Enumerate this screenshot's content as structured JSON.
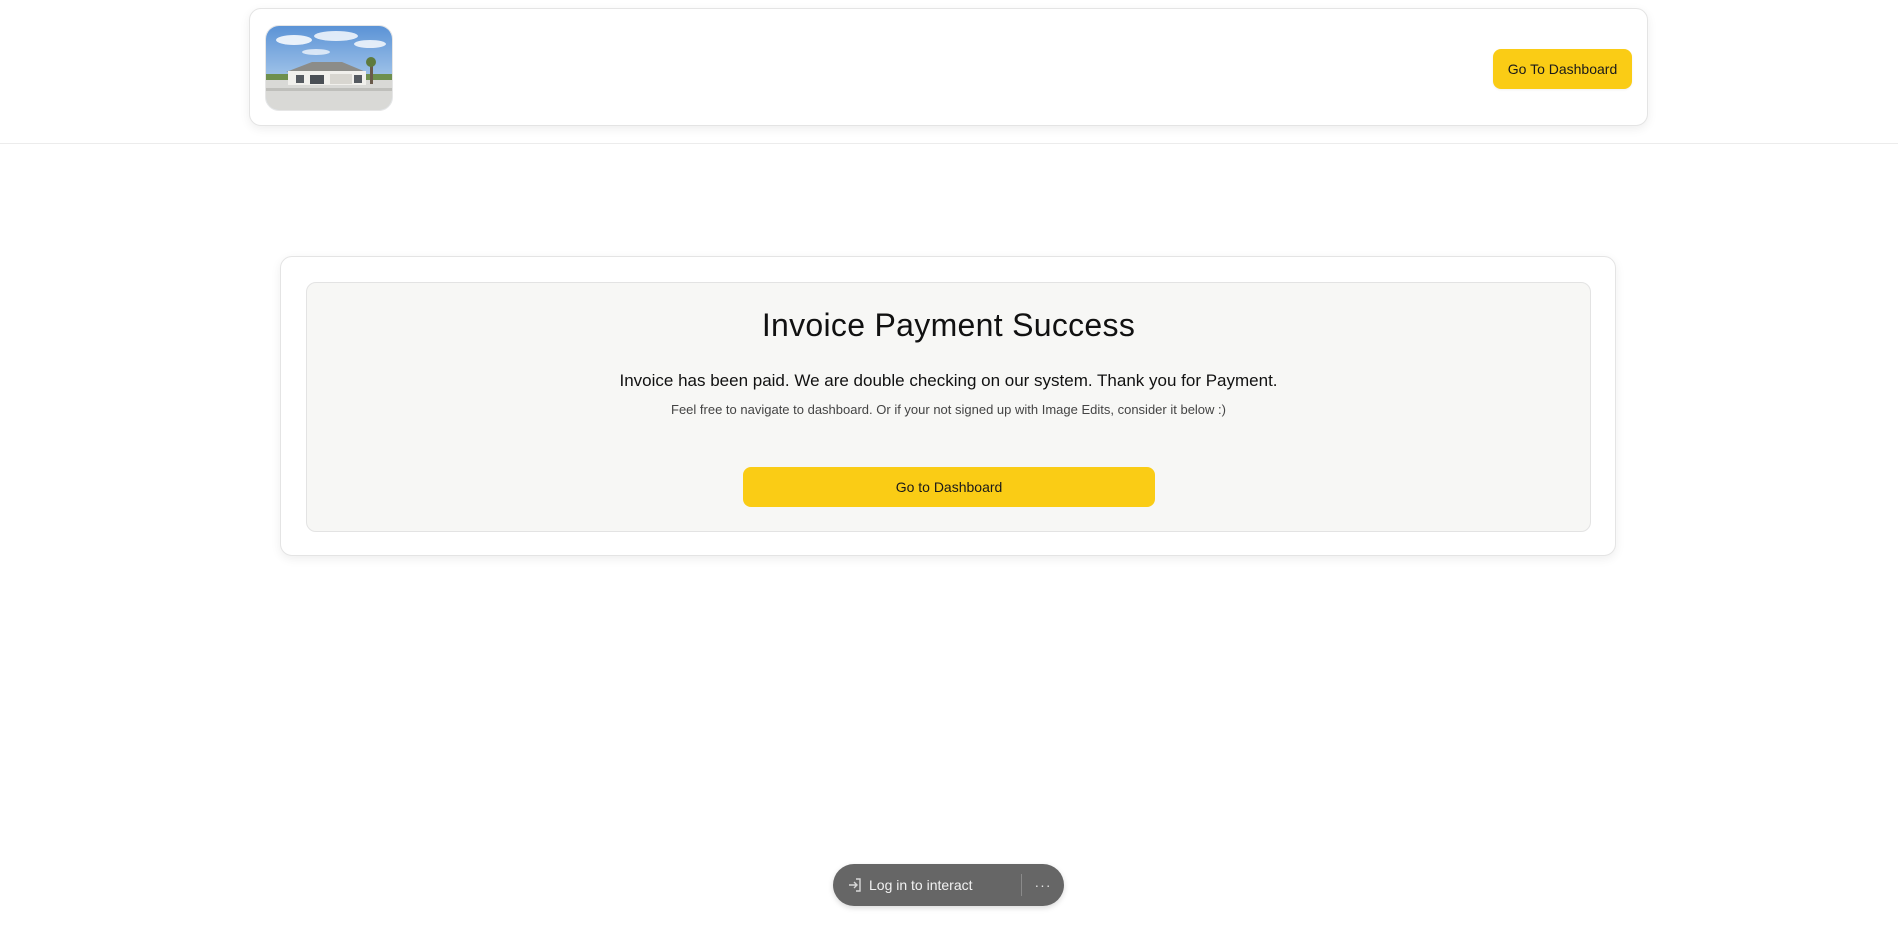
{
  "header": {
    "logo_alt": "house photo logo",
    "dashboard_button_label": "Go To Dashboard"
  },
  "main": {
    "title": "Invoice Payment Success",
    "message": "Invoice has been paid. We are double checking on our system. Thank you for Payment.",
    "note": "Feel free to navigate to dashboard. Or if your not signed up with Image Edits, consider it below :)",
    "dashboard_button_label": "Go to Dashboard"
  },
  "floating_bar": {
    "login_label": "Log in to interact",
    "login_icon": "login-arrow-icon",
    "more_icon": "more-dots-icon",
    "more_glyph": "···"
  },
  "colors": {
    "accent_yellow": "#facc15",
    "panel_bg": "#f7f7f5",
    "pill_bg": "#666666"
  }
}
